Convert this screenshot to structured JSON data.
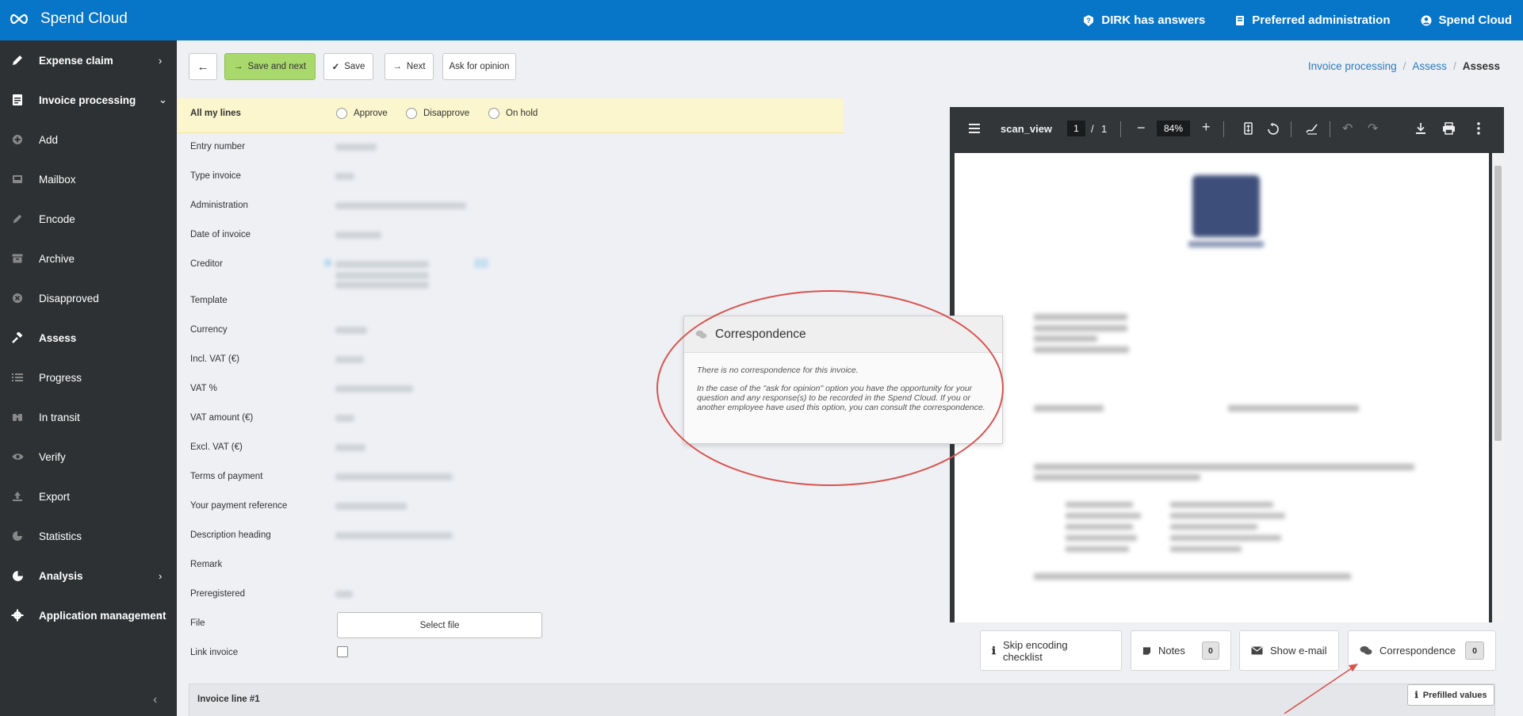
{
  "header": {
    "brand": "Spend Cloud",
    "nav": [
      {
        "label": "DIRK has answers",
        "icon": "help-icon"
      },
      {
        "label": "Preferred administration",
        "icon": "book-icon"
      },
      {
        "label": "Spend Cloud",
        "icon": "user-icon"
      }
    ]
  },
  "sidebar": {
    "items": [
      {
        "label": "Expense claim",
        "icon": "pencil-icon",
        "chevron": "›"
      },
      {
        "label": "Invoice processing",
        "icon": "document-icon",
        "chevron": "⌄"
      },
      {
        "label": "Add",
        "icon": "plus-circle-icon"
      },
      {
        "label": "Mailbox",
        "icon": "inbox-icon"
      },
      {
        "label": "Encode",
        "icon": "pencil-icon"
      },
      {
        "label": "Archive",
        "icon": "archive-icon"
      },
      {
        "label": "Disapproved",
        "icon": "x-circle-icon"
      },
      {
        "label": "Assess",
        "icon": "gavel-icon"
      },
      {
        "label": "Progress",
        "icon": "list-icon"
      },
      {
        "label": "In transit",
        "icon": "binoculars-icon"
      },
      {
        "label": "Verify",
        "icon": "eye-icon"
      },
      {
        "label": "Export",
        "icon": "upload-icon"
      },
      {
        "label": "Statistics",
        "icon": "pie-chart-icon"
      },
      {
        "label": "Analysis",
        "icon": "pie-chart-icon",
        "chevron": "›"
      },
      {
        "label": "Application management",
        "icon": "gear-icon",
        "chevron": "›"
      }
    ],
    "collapse": "‹"
  },
  "toolbar": {
    "back": "←",
    "save_next": "Save and next",
    "save": "Save",
    "next": "Next",
    "ask": "Ask for opinion"
  },
  "breadcrumb": {
    "item1": "Invoice processing",
    "item2": "Assess",
    "current": "Assess",
    "sep": "/"
  },
  "lines": {
    "label": "All my lines",
    "options": [
      "Approve",
      "Disapprove",
      "On hold"
    ]
  },
  "fields": [
    "Entry number",
    "Type invoice",
    "Administration",
    "Date of invoice",
    "Creditor",
    "Template",
    "Currency",
    "Incl. VAT (€)",
    "VAT %",
    "VAT amount (€)",
    "Excl. VAT (€)",
    "Terms of payment",
    "Your payment reference",
    "Description heading",
    "Remark",
    "Preregistered",
    "File",
    "Link invoice"
  ],
  "file_button": "Select file",
  "invoice_line": {
    "title": "Invoice line #1",
    "prefilled": "Prefilled values"
  },
  "pdf": {
    "title": "scan_view",
    "page": "1",
    "page_sep": "/",
    "pages": "1",
    "zoom": "84%",
    "minus": "−",
    "plus": "+"
  },
  "correspondence_popup": {
    "title": "Correspondence",
    "text1": "There is no correspondence for this invoice.",
    "text2": "In the case of the \"ask for opinion\" option you have the opportunity for your question and any response(s) to be recorded in the Spend Cloud. If you or another employee have used this option, you can consult the correspondence."
  },
  "bottom_buttons": {
    "skip": "Skip encoding checklist",
    "notes": "Notes",
    "notes_count": "0",
    "email": "Show e-mail",
    "corr": "Correspondence",
    "corr_count": "0"
  },
  "colors": {
    "header": "#0775c8",
    "sidebar": "#2e3133",
    "primary_button": "#a9d96c",
    "annotation": "#d9534f"
  }
}
